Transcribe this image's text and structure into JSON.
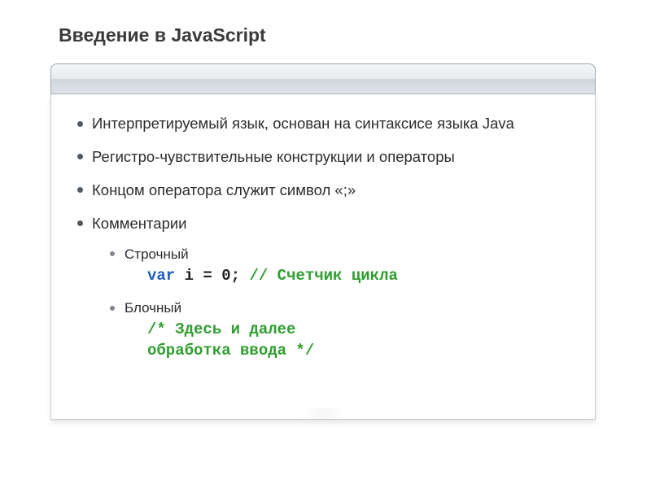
{
  "title": "Введение в JavaScript",
  "bullets": {
    "b0": "Интерпретируемый язык, основан на синтаксисе языка Java",
    "b1": "Регистро-чувствительные конструкции и операторы",
    "b2": "Концом оператора служит символ «;»",
    "b3": "Комментарии",
    "sub": {
      "s0": "Строчный",
      "s1": "Блочный"
    }
  },
  "code": {
    "line_kw": "var",
    "line_rest": " i = 0; ",
    "line_comment": "// Счетчик цикла",
    "block_l1": "/* Здесь и далее",
    "block_l2": "обработка ввода */"
  }
}
